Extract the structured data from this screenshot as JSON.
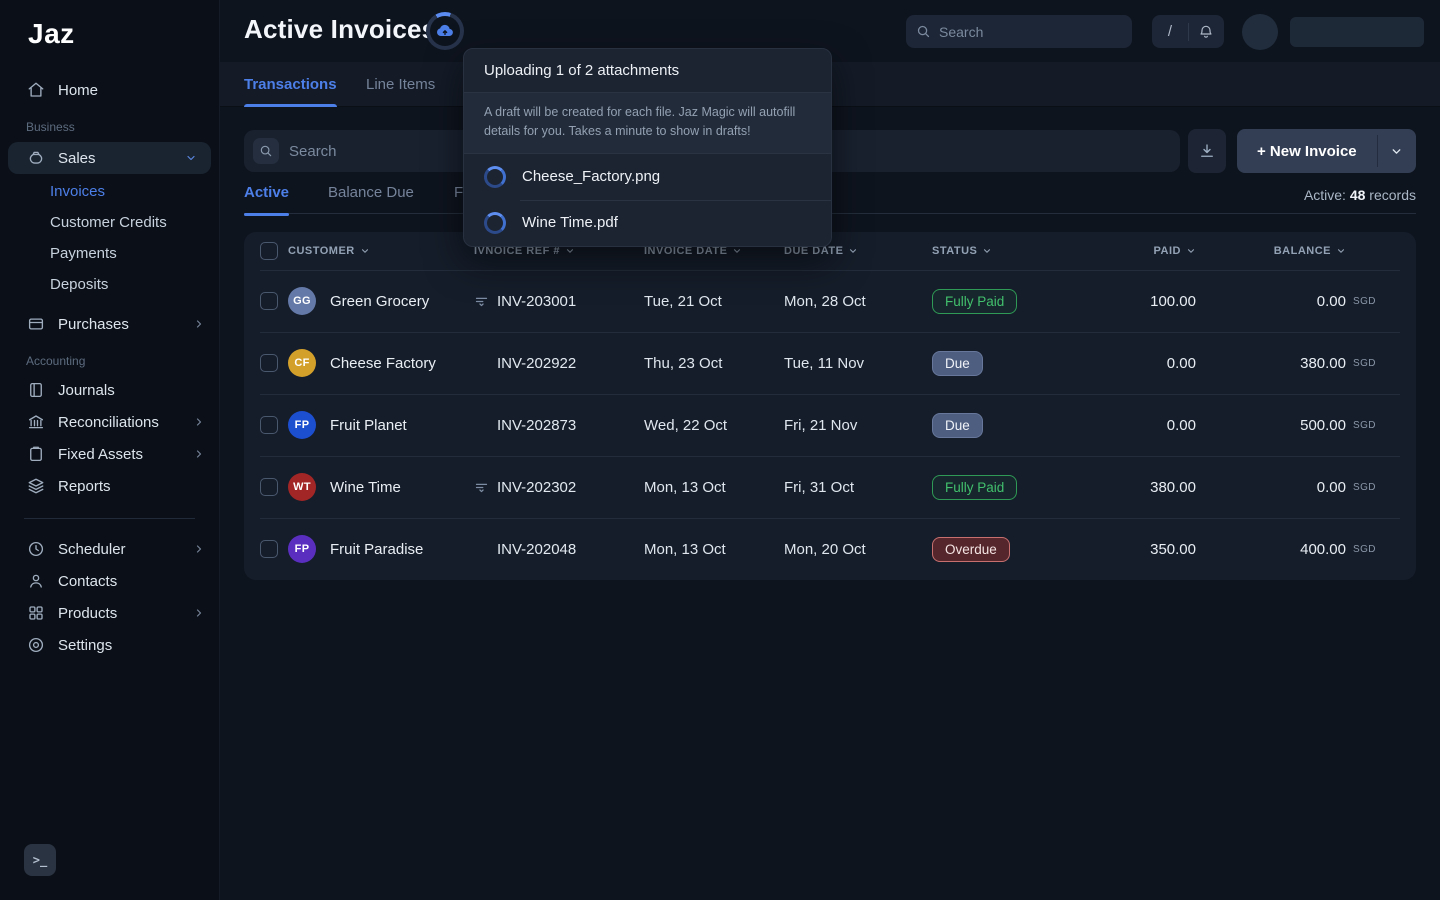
{
  "brand": {
    "logo": "Jaz"
  },
  "sidebar": {
    "home": "Home",
    "business_label": "Business",
    "sales": "Sales",
    "sales_children": [
      {
        "label": "Invoices"
      },
      {
        "label": "Customer Credits"
      },
      {
        "label": "Payments"
      },
      {
        "label": "Deposits"
      }
    ],
    "purchases": "Purchases",
    "accounting_label": "Accounting",
    "accounting_items": [
      {
        "label": "Journals"
      },
      {
        "label": "Reconciliations"
      },
      {
        "label": "Fixed Assets"
      },
      {
        "label": "Reports"
      }
    ],
    "bottom_items": [
      {
        "label": "Scheduler"
      },
      {
        "label": "Contacts"
      },
      {
        "label": "Products"
      },
      {
        "label": "Settings"
      }
    ],
    "terminal_glyph": ">_"
  },
  "topbar": {
    "title": "Active Invoices",
    "search_placeholder": "Search",
    "shortcut_key": "/"
  },
  "tabs": [
    {
      "label": "Transactions"
    },
    {
      "label": "Line Items"
    }
  ],
  "toolbar": {
    "search_placeholder": "Search",
    "new_invoice_label": "+ New Invoice"
  },
  "filters": {
    "tabs": [
      {
        "label": "Active"
      },
      {
        "label": "Balance Due"
      },
      {
        "label": "Fo"
      }
    ],
    "records_prefix": "Active: ",
    "records_count": "48",
    "records_suffix": " records"
  },
  "upload_popup": {
    "title": "Uploading 1 of 2 attachments",
    "description": "A draft will be created for each file. Jaz Magic will autofill details for you. Takes a minute to show in drafts!",
    "files": [
      {
        "name": "Cheese_Factory.png"
      },
      {
        "name": "Wine Time.pdf"
      }
    ]
  },
  "table": {
    "columns": [
      "Customer",
      "Ivnoice Ref #",
      "Invoice Date",
      "Due Date",
      "Status",
      "Paid",
      "Balance"
    ],
    "currency": "SGD",
    "rows": [
      {
        "initials": "GG",
        "avatar_color": "#6479a8",
        "customer": "Green Grocery",
        "ref": "INV-203001",
        "invoice_date": "Tue, 21 Oct",
        "due_date": "Mon, 28 Oct",
        "status": "Fully Paid",
        "paid": "100.00",
        "balance": "0.00"
      },
      {
        "initials": "CF",
        "avatar_color": "#d3a02a",
        "customer": "Cheese Factory",
        "ref": "INV-202922",
        "invoice_date": "Thu, 23 Oct",
        "due_date": "Tue, 11 Nov",
        "status": "Due",
        "paid": "0.00",
        "balance": "380.00"
      },
      {
        "initials": "FP",
        "avatar_color": "#1c4ed0",
        "customer": "Fruit Planet",
        "ref": "INV-202873",
        "invoice_date": "Wed, 22 Oct",
        "due_date": "Fri, 21 Nov",
        "status": "Due",
        "paid": "0.00",
        "balance": "500.00"
      },
      {
        "initials": "WT",
        "avatar_color": "#a32626",
        "customer": "Wine Time",
        "ref": "INV-202302",
        "invoice_date": "Mon, 13 Oct",
        "due_date": "Fri, 31 Oct",
        "status": "Fully Paid",
        "paid": "380.00",
        "balance": "0.00"
      },
      {
        "initials": "FP",
        "avatar_color": "#5a2fc0",
        "customer": "Fruit Paradise",
        "ref": "INV-202048",
        "invoice_date": "Mon, 13 Oct",
        "due_date": "Mon, 20 Oct",
        "status": "Overdue",
        "paid": "350.00",
        "balance": "400.00"
      }
    ]
  },
  "colors": {
    "accent_blue": "#4d7fe8",
    "paid_green": "#42c06d",
    "due_slate": "#4e5e80",
    "overdue_red": "#c76f6f"
  }
}
